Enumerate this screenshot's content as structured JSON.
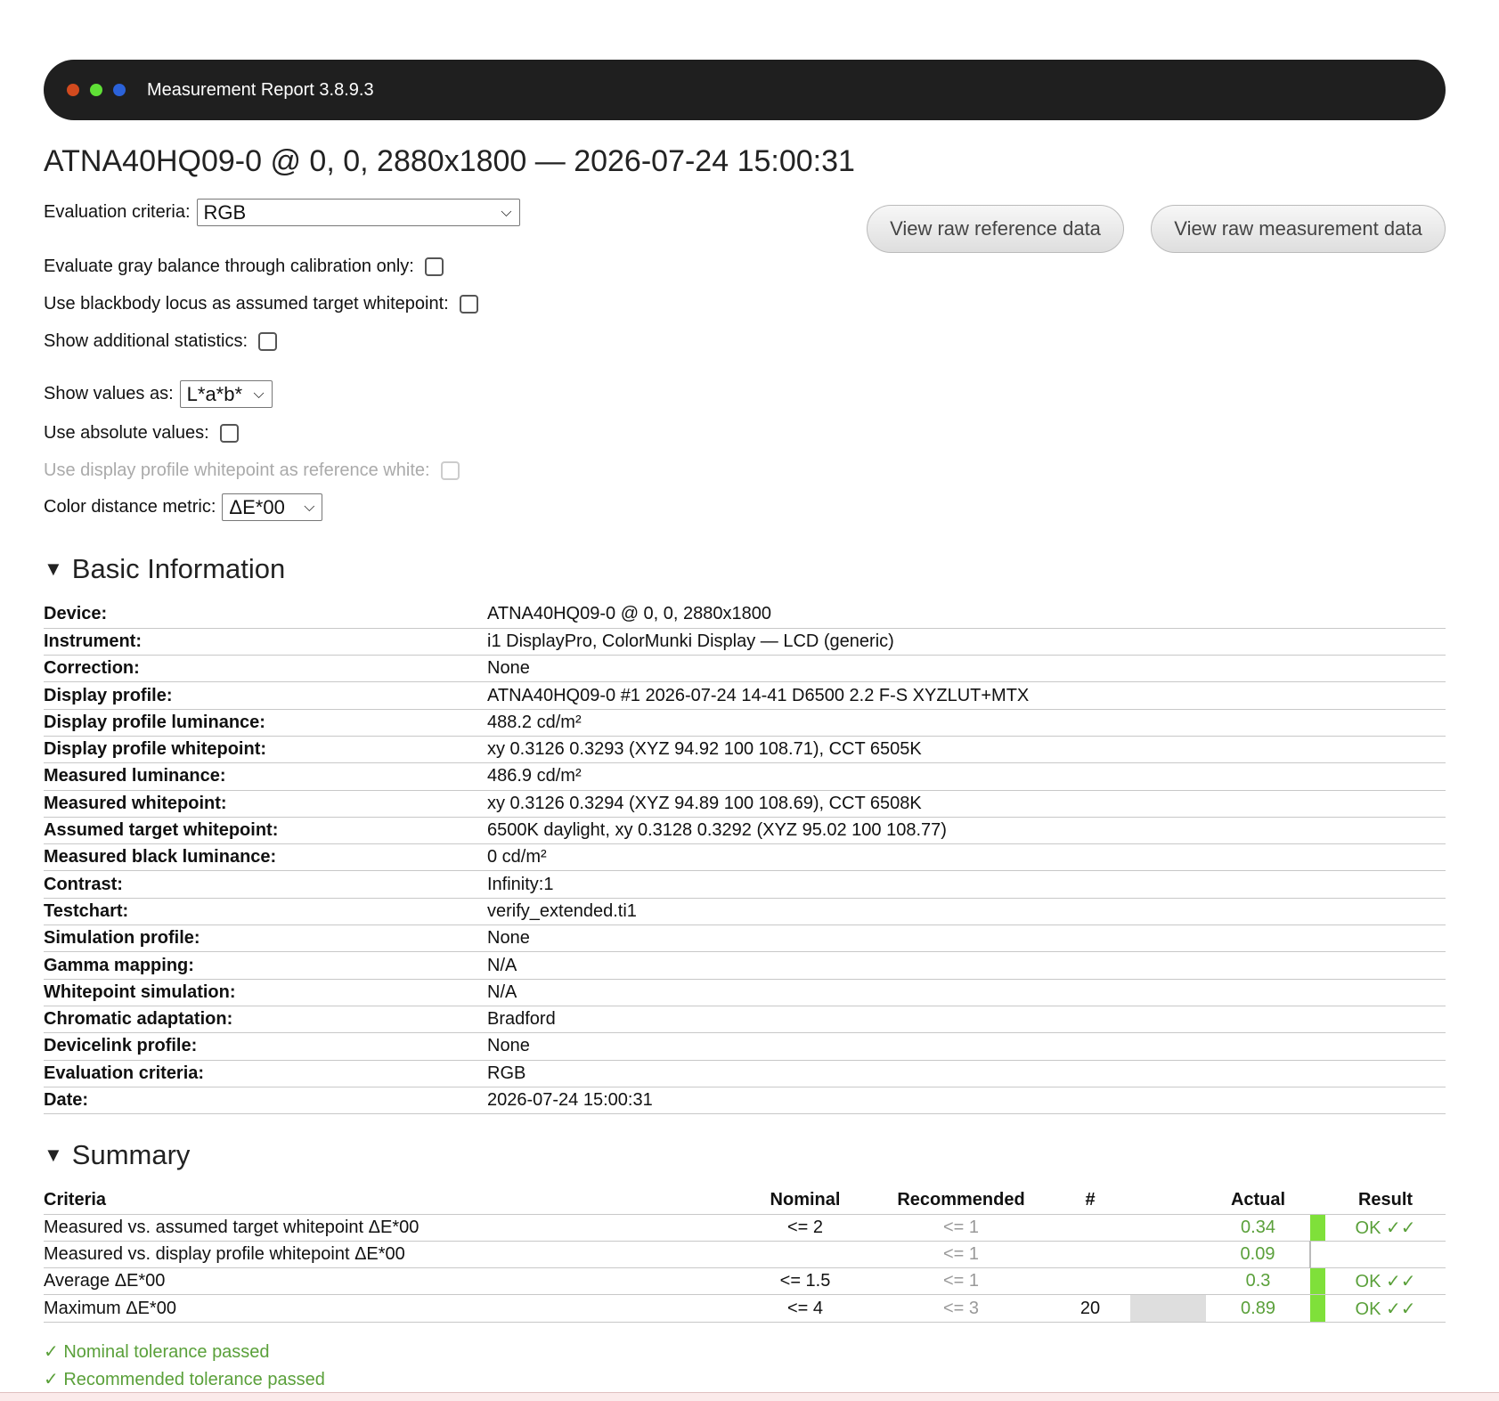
{
  "window": {
    "title": "Measurement Report 3.8.9.3",
    "dots": [
      "#d24a1e",
      "#5fe036",
      "#2b62d9"
    ]
  },
  "report_title": "ATNA40HQ09-0 @ 0, 0, 2880x1800 — 2026-07-24 15:00:31",
  "controls": {
    "evaluation_criteria_label": "Evaluation criteria:",
    "evaluation_criteria_value": "RGB",
    "gray_balance_label": "Evaluate gray balance through calibration only:",
    "blackbody_label": "Use blackbody locus as assumed target whitepoint:",
    "additional_stats_label": "Show additional statistics:",
    "show_values_label": "Show values as:",
    "show_values_value": "L*a*b*",
    "absolute_label": "Use absolute values:",
    "profile_white_label": "Use display profile whitepoint as reference white:",
    "distance_label": "Color distance metric:",
    "distance_value": "ΔE*00"
  },
  "buttons": {
    "raw_reference": "View raw reference data",
    "raw_measurement": "View raw measurement data"
  },
  "basic_info": {
    "heading": "Basic Information",
    "rows": [
      {
        "key": "Device:",
        "value": "ATNA40HQ09-0 @ 0, 0, 2880x1800"
      },
      {
        "key": "Instrument:",
        "value": "i1 DisplayPro, ColorMunki Display — LCD (generic)"
      },
      {
        "key": "Correction:",
        "value": "None"
      },
      {
        "key": "Display profile:",
        "value": "ATNA40HQ09-0 #1 2026-07-24 14-41 D6500 2.2 F-S XYZLUT+MTX"
      },
      {
        "key": "Display profile luminance:",
        "value": "488.2 cd/m²"
      },
      {
        "key": "Display profile whitepoint:",
        "value": "xy 0.3126 0.3293 (XYZ 94.92 100 108.71), CCT 6505K"
      },
      {
        "key": "Measured luminance:",
        "value": "486.9 cd/m²"
      },
      {
        "key": "Measured whitepoint:",
        "value": "xy 0.3126 0.3294 (XYZ 94.89 100 108.69), CCT 6508K"
      },
      {
        "key": "Assumed target whitepoint:",
        "value": "6500K daylight, xy 0.3128 0.3292 (XYZ 95.02 100 108.77)"
      },
      {
        "key": "Measured black luminance:",
        "value": "0 cd/m²"
      },
      {
        "key": "Contrast:",
        "value": "Infinity:1"
      },
      {
        "key": "Testchart:",
        "value": "verify_extended.ti1"
      },
      {
        "key": "Simulation profile:",
        "value": "None"
      },
      {
        "key": "Gamma mapping:",
        "value": "N/A"
      },
      {
        "key": "Whitepoint simulation:",
        "value": "N/A"
      },
      {
        "key": "Chromatic adaptation:",
        "value": "Bradford"
      },
      {
        "key": "Devicelink profile:",
        "value": "None"
      },
      {
        "key": "Evaluation criteria:",
        "value": "RGB"
      },
      {
        "key": "Date:",
        "value": "2026-07-24 15:00:31"
      }
    ]
  },
  "summary": {
    "heading": "Summary",
    "headers": {
      "criteria": "Criteria",
      "nominal": "Nominal",
      "recommended": "Recommended",
      "count": "#",
      "actual": "Actual",
      "result": "Result"
    },
    "rows": [
      {
        "criteria": "Measured vs. assumed target whitepoint ΔE*00",
        "nominal": "<= 2",
        "recommended": "<= 1",
        "count": "",
        "actual": "0.34",
        "result": "OK ✓✓"
      },
      {
        "criteria": "Measured vs. display profile whitepoint ΔE*00",
        "nominal": "",
        "recommended": "<= 1",
        "count": "",
        "actual": "0.09",
        "result": ""
      },
      {
        "criteria": "Average ΔE*00",
        "nominal": "<= 1.5",
        "recommended": "<= 1",
        "count": "",
        "actual": "0.3",
        "result": "OK ✓✓"
      },
      {
        "criteria": "Maximum ΔE*00",
        "nominal": "<= 4",
        "recommended": "<= 3",
        "count": "20",
        "actual": "0.89",
        "result": "OK ✓✓"
      }
    ],
    "pass_nominal": "✓ Nominal tolerance passed",
    "pass_recommended": "✓ Recommended tolerance passed"
  }
}
